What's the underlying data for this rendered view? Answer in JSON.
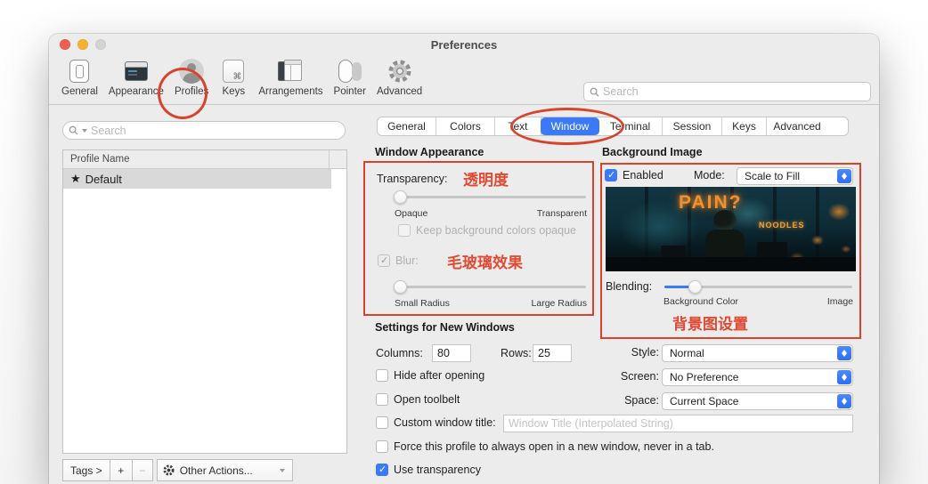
{
  "window": {
    "title": "Preferences"
  },
  "toolbar": {
    "items": [
      {
        "label": "General"
      },
      {
        "label": "Appearance"
      },
      {
        "label": "Profiles"
      },
      {
        "label": "Keys"
      },
      {
        "label": "Arrangements"
      },
      {
        "label": "Pointer"
      },
      {
        "label": "Advanced"
      }
    ],
    "search_placeholder": "Search"
  },
  "sidebar": {
    "search_placeholder": "Search",
    "table_header": "Profile Name",
    "profiles": [
      {
        "star": "★",
        "name": "Default"
      }
    ],
    "footer": {
      "tags_label": "Tags >",
      "add_label": "+",
      "remove_label": "−",
      "other_actions_label": "Other Actions..."
    }
  },
  "tabs": {
    "items": [
      {
        "label": "General"
      },
      {
        "label": "Colors"
      },
      {
        "label": "Text"
      },
      {
        "label": "Window"
      },
      {
        "label": "Terminal"
      },
      {
        "label": "Session"
      },
      {
        "label": "Keys"
      },
      {
        "label": "Advanced"
      }
    ],
    "selected": "Window"
  },
  "window_appearance": {
    "title": "Window Appearance",
    "transparency_label": "Transparency:",
    "transparency_annotation": "透明度",
    "transparency_pct": 2,
    "opaque_label": "Opaque",
    "transparent_label": "Transparent",
    "keep_bg_label": "Keep background colors opaque",
    "keep_bg_checked": false,
    "blur_label": "Blur:",
    "blur_checked": true,
    "blur_annotation": "毛玻璃效果",
    "blur_pct": 2,
    "small_radius_label": "Small Radius",
    "large_radius_label": "Large Radius"
  },
  "background_image": {
    "title": "Background Image",
    "enabled_label": "Enabled",
    "enabled_checked": true,
    "mode_label": "Mode:",
    "mode_value": "Scale to Fill",
    "preview_neon_text": "PAIN?",
    "preview_neon_text2": "NOODLES",
    "blending_label": "Blending:",
    "blending_pct": 16,
    "background_color_label": "Background Color",
    "image_label": "Image",
    "annotation": "背景图设置"
  },
  "new_windows": {
    "title": "Settings for New Windows",
    "columns_label": "Columns:",
    "columns_value": "80",
    "rows_label": "Rows:",
    "rows_value": "25",
    "style_label": "Style:",
    "style_value": "Normal",
    "hide_after_opening_label": "Hide after opening",
    "hide_after_opening_checked": false,
    "screen_label": "Screen:",
    "screen_value": "No Preference",
    "open_toolbelt_label": "Open toolbelt",
    "open_toolbelt_checked": false,
    "space_label": "Space:",
    "space_value": "Current Space",
    "custom_title_label": "Custom window title:",
    "custom_title_checked": false,
    "custom_title_placeholder": "Window Title (Interpolated String)",
    "force_label": "Force this profile to always open in a new window, never in a tab.",
    "force_checked": false,
    "use_transparency_label": "Use transparency",
    "use_transparency_checked": true
  },
  "colors": {
    "accent": "#3b79f7",
    "annotation": "#d8432c",
    "neon": "#f29030"
  }
}
